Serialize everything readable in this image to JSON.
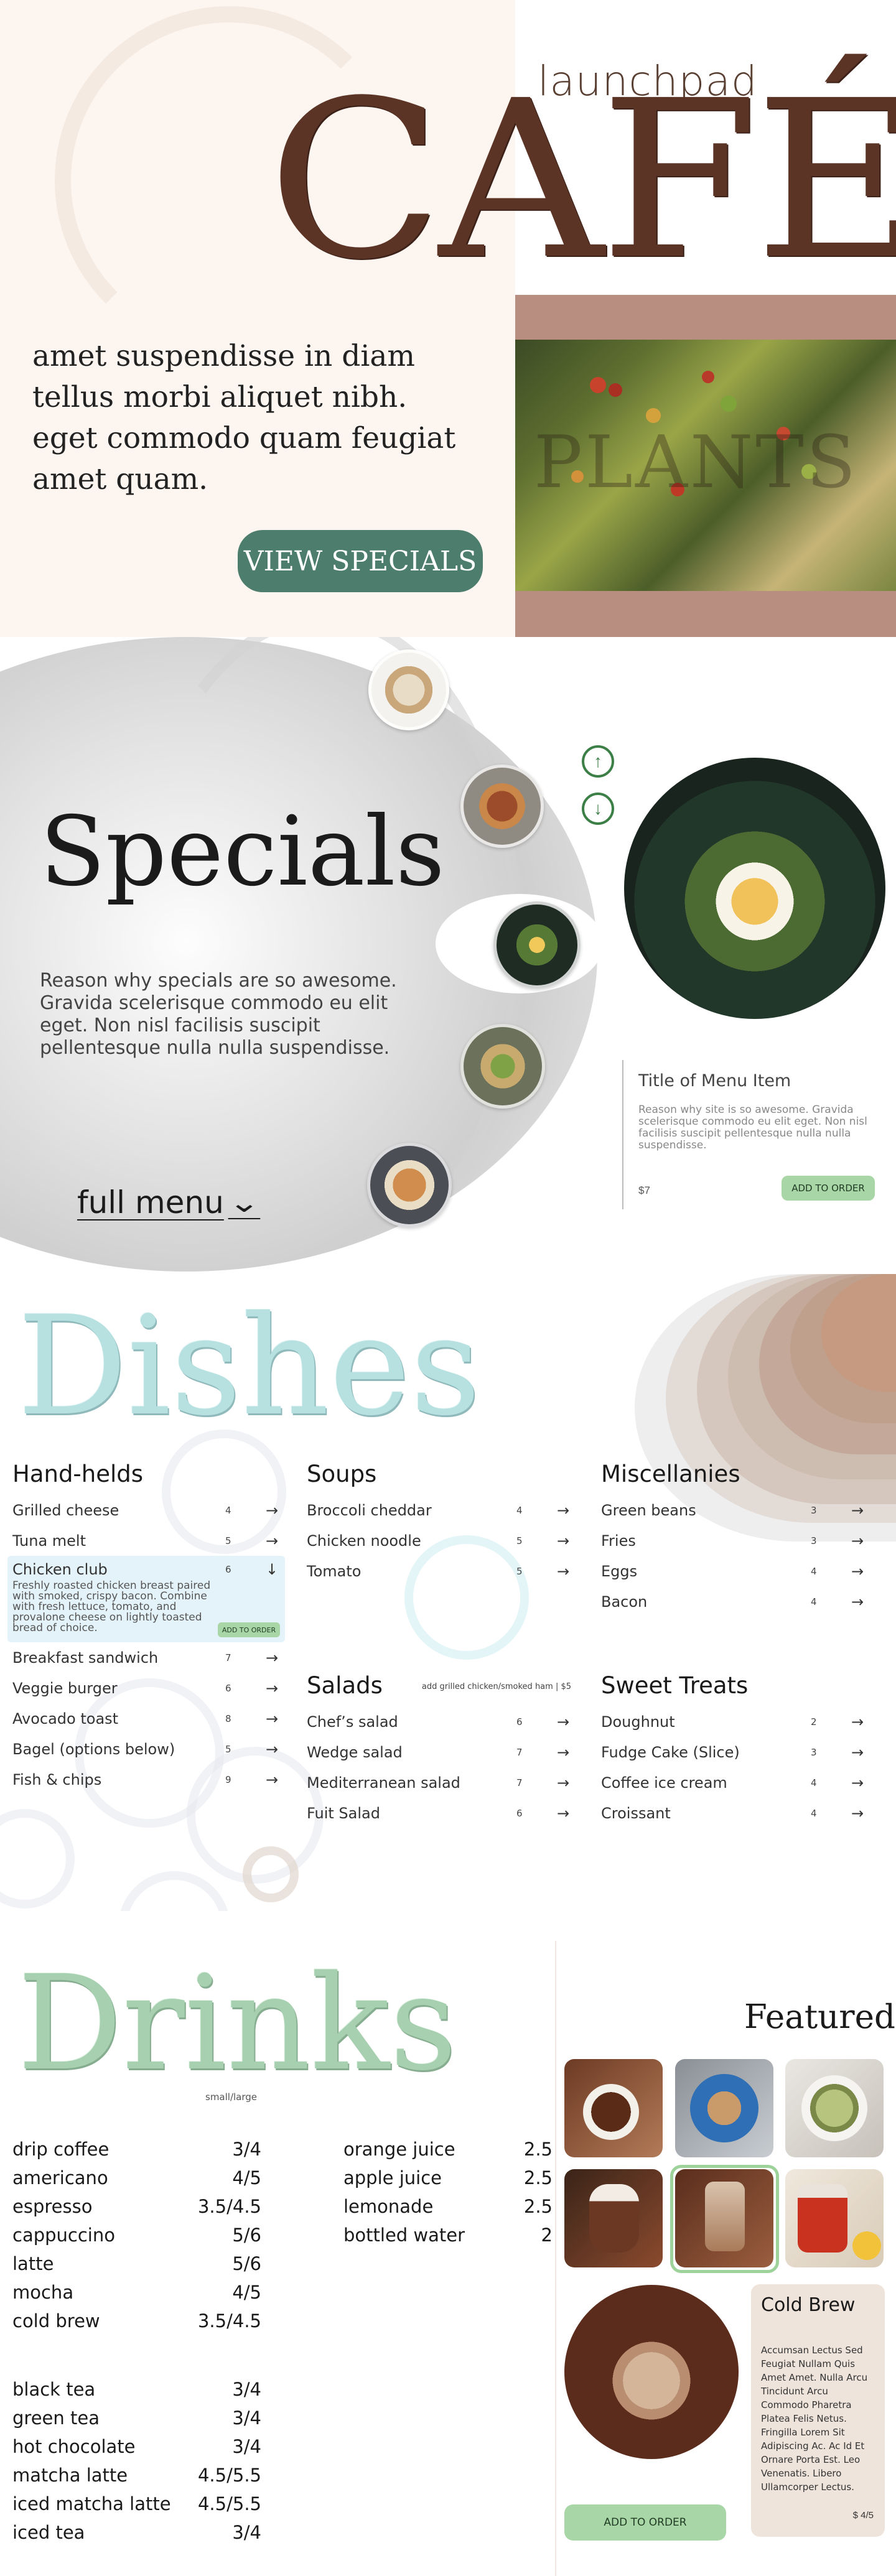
{
  "hero": {
    "brand": "launchpad",
    "title": "CAFÉ",
    "tagline": "amet suspendisse in diam tellus morbi aliquet nibh. eget commodo quam feugiat amet quam.",
    "cta_label": "VIEW SPECIALS",
    "image_overlay_text": "PLANTS",
    "colors": {
      "accent": "#4d7d6c",
      "title": "#5c3426",
      "band": "#b78e80",
      "cream": "#fdf5ef"
    }
  },
  "specials": {
    "heading": "Specials",
    "description": "Reason why specials are so awesome. Gravida scelerisque commodo eu elit eget. Non nisl facilisis suscipit pellentesque nulla nulla suspendisse.",
    "full_menu_label": "full menu",
    "card": {
      "title": "Title of Menu Item",
      "description": "Reason why site is so awesome. Gravida scelerisque commodo eu elit eget. Non nisl facilisis suscipit pellentesque nulla nulla suspendisse.",
      "price": "$7",
      "order_label": "ADD TO ORDER"
    }
  },
  "dishes": {
    "heading": "Dishes",
    "handhelds": {
      "title": "Hand-helds",
      "items": [
        {
          "name": "Grilled cheese",
          "price": "4"
        },
        {
          "name": "Tuna melt",
          "price": "5"
        },
        {
          "name": "Chicken club",
          "price": "6",
          "description": "Freshly roasted chicken breast paired with smoked, crispy bacon. Combine with fresh lettuce, tomato, and provalone cheese on lightly toasted bread of choice.",
          "order_label": "ADD TO ORDER"
        },
        {
          "name": "Breakfast sandwich",
          "price": "7"
        },
        {
          "name": "Veggie burger",
          "price": "6"
        },
        {
          "name": "Avocado toast",
          "price": "8"
        },
        {
          "name": "Bagel (options below)",
          "price": "5"
        },
        {
          "name": "Fish & chips",
          "price": "9"
        }
      ]
    },
    "soups": {
      "title": "Soups",
      "items": [
        {
          "name": "Broccoli cheddar",
          "price": "4"
        },
        {
          "name": "Chicken noodle",
          "price": "5"
        },
        {
          "name": "Tomato",
          "price": "5"
        }
      ]
    },
    "salads": {
      "title": "Salads",
      "note": "add grilled chicken/smoked ham | $5",
      "items": [
        {
          "name": "Chef’s salad",
          "price": "6"
        },
        {
          "name": "Wedge salad",
          "price": "7"
        },
        {
          "name": "Mediterranean salad",
          "price": "7"
        },
        {
          "name": "Fuit Salad",
          "price": "6"
        }
      ]
    },
    "misc": {
      "title": "Miscellanies",
      "items": [
        {
          "name": "Green beans",
          "price": "3"
        },
        {
          "name": "Fries",
          "price": "3"
        },
        {
          "name": "Eggs",
          "price": "4"
        },
        {
          "name": "Bacon",
          "price": "4"
        }
      ]
    },
    "sweets": {
      "title": "Sweet Treats",
      "items": [
        {
          "name": "Doughnut",
          "price": "2"
        },
        {
          "name": "Fudge Cake (Slice)",
          "price": "3"
        },
        {
          "name": "Coffee ice cream",
          "price": "4"
        },
        {
          "name": "Croissant",
          "price": "4"
        }
      ]
    }
  },
  "drinks": {
    "heading": "Drinks",
    "sizes_label": "small/large",
    "coffee": [
      {
        "name": "drip coffee",
        "price": "3/4"
      },
      {
        "name": "americano",
        "price": "4/5"
      },
      {
        "name": "espresso",
        "price": "3.5/4.5"
      },
      {
        "name": "cappuccino",
        "price": "5/6"
      },
      {
        "name": "latte",
        "price": "5/6"
      },
      {
        "name": "mocha",
        "price": "4/5"
      },
      {
        "name": "cold brew",
        "price": "3.5/4.5"
      }
    ],
    "tea": [
      {
        "name": "black tea",
        "price": "3/4"
      },
      {
        "name": "green tea",
        "price": "3/4"
      },
      {
        "name": "hot chocolate",
        "price": "3/4"
      },
      {
        "name": "matcha latte",
        "price": "4.5/5.5"
      },
      {
        "name": "iced matcha latte",
        "price": "4.5/5.5"
      },
      {
        "name": "iced tea",
        "price": "3/4"
      }
    ],
    "other": [
      {
        "name": "orange juice",
        "price": "2.5"
      },
      {
        "name": "apple juice",
        "price": "2.5"
      },
      {
        "name": "lemonade",
        "price": "2.5"
      },
      {
        "name": "bottled water",
        "price": "2"
      }
    ],
    "featured_heading": "Featured",
    "featured": {
      "title": "Cold Brew",
      "description": "Accumsan Lectus Sed Feugiat Nullam Quis Amet Amet. Nulla Arcu Tincidunt Arcu Commodo Pharetra Platea Felis Netus. Fringilla Lorem Sit Adipiscing Ac. Ac Id Et Ornare Porta Est. Leo Venenatis. Libero Ullamcorper Lectus.",
      "price": "$ 4/5",
      "order_label": "ADD TO ORDER"
    }
  }
}
